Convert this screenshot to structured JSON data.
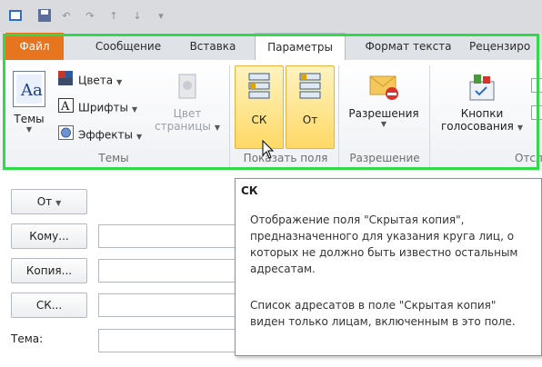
{
  "quick_access": {
    "icons": [
      "outlook-icon",
      "save-icon",
      "undo-icon",
      "redo-icon",
      "up-icon",
      "down-icon",
      "customize-icon"
    ]
  },
  "tabs": [
    {
      "label": "Файл"
    },
    {
      "label": "Сообщение"
    },
    {
      "label": "Вставка"
    },
    {
      "label": "Параметры"
    },
    {
      "label": "Формат текста"
    },
    {
      "label": "Рецензиро"
    }
  ],
  "ribbon": {
    "themes": {
      "themes_label": "Темы",
      "colors_label": "Цвета",
      "fonts_label": "Шрифты",
      "effects_label": "Эффекты",
      "page_color_line1": "Цвет",
      "page_color_line2": "страницы",
      "group_label": "Темы"
    },
    "show_fields": {
      "bcc_label": "СК",
      "from_label": "От",
      "group_label": "Показать поля"
    },
    "permissions": {
      "label": "Разрешения",
      "group_label": "Разрешение"
    },
    "tracking": {
      "voting_line1": "Кнопки",
      "voting_line2": "голосования",
      "group_label": "Отсл"
    }
  },
  "message": {
    "from_button": "От",
    "to_button": "Кому...",
    "cc_button": "Копия...",
    "bcc_button": "СК...",
    "subject_label": "Тема:"
  },
  "tooltip": {
    "title": "СК",
    "paragraph1": "Отображение поля \"Скрытая копия\", предназначенного для указания круга лиц, о которых не должно быть известно остальным адресатам.",
    "paragraph2": "Список адресатов в поле \"Скрытая копия\" виден только лицам, включенным в это поле."
  },
  "colors": {
    "file_tab": "#e7741f",
    "highlight_frame": "#33d94a",
    "hot_button": "#ffd966"
  }
}
